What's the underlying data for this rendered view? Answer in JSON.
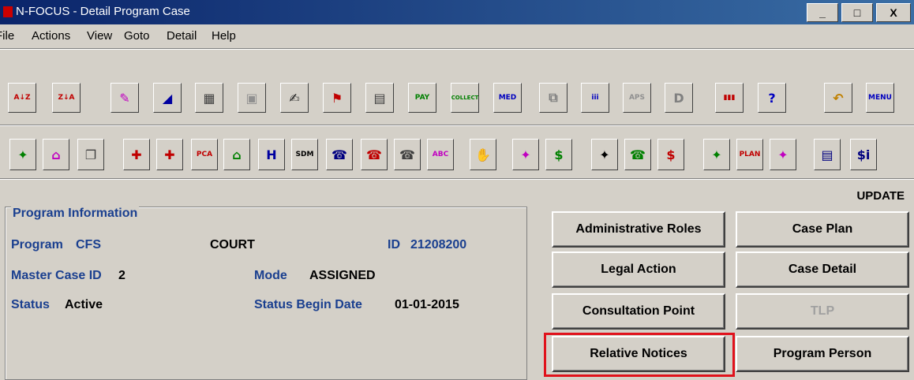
{
  "window": {
    "title": "N-FOCUS - Detail Program Case",
    "minimize": "_",
    "maximize": "□",
    "close": "X"
  },
  "menu": [
    "File",
    "Actions",
    "View",
    "Goto",
    "Detail",
    "Help"
  ],
  "toolbar1": [
    {
      "icon": "sort-az-icon",
      "glyph": "A↓Z",
      "color": "#c00000"
    },
    {
      "icon": "sort-za-icon",
      "glyph": "Z↓A",
      "color": "#c00000"
    },
    {
      "icon": "person-edit-icon",
      "glyph": "✎",
      "color": "#c000c0"
    },
    {
      "icon": "eraser-icon",
      "glyph": "◢",
      "color": "#0000a0"
    },
    {
      "icon": "calendar-icon",
      "glyph": "▦",
      "color": "#404040"
    },
    {
      "icon": "document-disabled-icon",
      "glyph": "▣",
      "color": "#909090"
    },
    {
      "icon": "notepad-edit-icon",
      "glyph": "✍",
      "color": "#202020"
    },
    {
      "icon": "flag-icon",
      "glyph": "⚑",
      "color": "#c00000"
    },
    {
      "icon": "document-stack-icon",
      "glyph": "▤",
      "color": "#404040"
    },
    {
      "icon": "pay-icon",
      "glyph": "PAY",
      "color": "#008000"
    },
    {
      "icon": "collect-icon",
      "glyph": "COLLECT",
      "color": "#008000"
    },
    {
      "icon": "medical-icon",
      "glyph": "MED",
      "color": "#0000c0"
    },
    {
      "icon": "copy-disabled-icon",
      "glyph": "⧉",
      "color": "#808080"
    },
    {
      "icon": "people-group-icon",
      "glyph": "iii",
      "color": "#0000c0"
    },
    {
      "icon": "aps-disabled-icon",
      "glyph": "APS",
      "color": "#909090"
    },
    {
      "icon": "detail-disabled-icon",
      "glyph": "D",
      "color": "#808080"
    },
    {
      "icon": "bar-chart-icon",
      "glyph": "▮▮▮",
      "color": "#c00000"
    },
    {
      "icon": "help-icon",
      "glyph": "?",
      "color": "#0000c0"
    },
    {
      "icon": "folder-back-icon",
      "glyph": "↶",
      "color": "#c08000"
    },
    {
      "icon": "menu-icon",
      "glyph": "MENU",
      "color": "#0000c0"
    }
  ],
  "toolbar2": [
    {
      "icon": "child-home-icon",
      "glyph": "✦",
      "color": "#008000"
    },
    {
      "icon": "household-icon",
      "glyph": "⌂",
      "color": "#c000c0"
    },
    {
      "icon": "copy-docs-icon",
      "glyph": "❐",
      "color": "#404040"
    },
    {
      "icon": "medical-check-icon",
      "glyph": "✚",
      "color": "#c00000"
    },
    {
      "icon": "medical-list-icon",
      "glyph": "✚",
      "color": "#c00000"
    },
    {
      "icon": "pca-icon",
      "glyph": "PCA",
      "color": "#c00000"
    },
    {
      "icon": "home-building-icon",
      "glyph": "⌂",
      "color": "#008000"
    },
    {
      "icon": "hospital-icon",
      "glyph": "H",
      "color": "#0000a0"
    },
    {
      "icon": "sdm-icon",
      "glyph": "SDM",
      "color": "#000000"
    },
    {
      "icon": "phone-blue-icon",
      "glyph": "☎",
      "color": "#000080"
    },
    {
      "icon": "phone-red-icon",
      "glyph": "☎",
      "color": "#c00000"
    },
    {
      "icon": "phone-calendar-icon",
      "glyph": "☎",
      "color": "#404040"
    },
    {
      "icon": "abc-house-icon",
      "glyph": "ABC",
      "color": "#c000c0"
    },
    {
      "icon": "handshake-icon",
      "glyph": "✋",
      "color": "#000080"
    },
    {
      "icon": "person-pay-icon",
      "glyph": "✦",
      "color": "#c000c0"
    },
    {
      "icon": "pay-dollar-icon",
      "glyph": "$",
      "color": "#008000"
    },
    {
      "icon": "family-icon",
      "glyph": "✦",
      "color": "#000000"
    },
    {
      "icon": "phone-green-icon",
      "glyph": "☎",
      "color": "#008000"
    },
    {
      "icon": "subsidy-dollar-icon",
      "glyph": "$",
      "color": "#c00000"
    },
    {
      "icon": "person-form-icon",
      "glyph": "✦",
      "color": "#008000"
    },
    {
      "icon": "plan-folder-icon",
      "glyph": "PLAN",
      "color": "#c00000"
    },
    {
      "icon": "people-pair-icon",
      "glyph": "✦",
      "color": "#c000c0"
    },
    {
      "icon": "report-icon",
      "glyph": "▤",
      "color": "#000080"
    },
    {
      "icon": "info-dollar-icon",
      "glyph": "$i",
      "color": "#000080"
    }
  ],
  "mode_label": "UPDATE",
  "program_info": {
    "title": "Program Information",
    "program_label": "Program",
    "program_value": "CFS",
    "program_type": "COURT",
    "id_label": "ID",
    "id_value": "21208200",
    "master_case_label": "Master Case ID",
    "master_case_value": "2",
    "mode_label": "Mode",
    "mode_value": "ASSIGNED",
    "status_label": "Status",
    "status_value": "Active",
    "status_begin_label": "Status Begin Date",
    "status_begin_value": "01-01-2015"
  },
  "buttons": {
    "administrative_roles": "Administrative Roles",
    "case_plan": "Case Plan",
    "legal_action": "Legal Action",
    "case_detail": "Case Detail",
    "consultation_point": "Consultation Point",
    "tlp": "TLP",
    "relative_notices": "Relative Notices",
    "program_person": "Program Person"
  },
  "colors": {
    "label_blue": "#1a3f8f",
    "highlight_red": "#e0121c",
    "face": "#d4d0c8"
  }
}
